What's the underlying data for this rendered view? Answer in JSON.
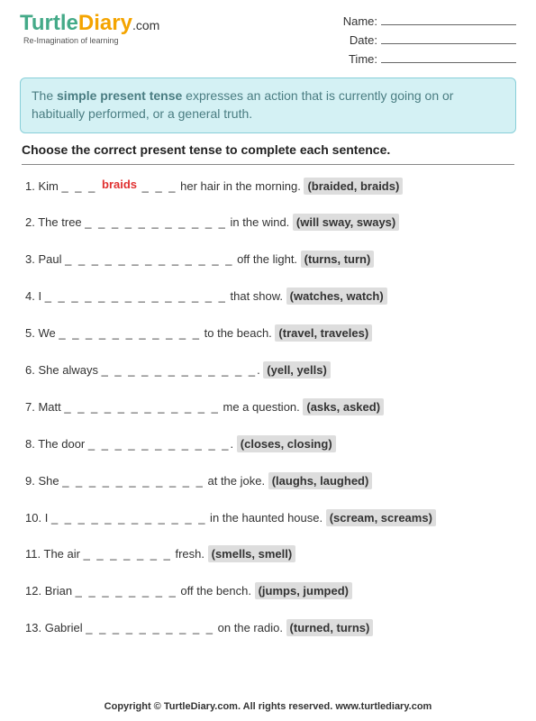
{
  "logo": {
    "brand1": "Turtle",
    "brand2": "Diary",
    "suffix": ".com",
    "tagline": "Re-Imagination of learning"
  },
  "fields": {
    "name_label": "Name:",
    "date_label": "Date:",
    "time_label": "Time:"
  },
  "definition": {
    "pre": "The ",
    "bold": "simple present tense",
    "post": " expresses an action that is currently going on or habitually performed, or a general truth."
  },
  "instruction": "Choose the correct present tense to complete each sentence.",
  "questions": [
    {
      "n": "1.",
      "pre": "Kim ",
      "blank_pre": "_ _ _ ",
      "answer": "braids",
      "blank_post": " _ _ _",
      "post": " her hair in the morning.  ",
      "options": "(braided, braids)"
    },
    {
      "n": "2.",
      "pre": "The tree ",
      "blank_pre": "_ _ _ _ _ _ _ _ _ _ _",
      "answer": "",
      "blank_post": "",
      "post": " in the wind.  ",
      "options": "(will sway, sways)"
    },
    {
      "n": "3.",
      "pre": "Paul ",
      "blank_pre": "_ _ _ _ _ _ _ _ _ _ _ _ _",
      "answer": "",
      "blank_post": "",
      "post": " off the light.  ",
      "options": "(turns, turn)"
    },
    {
      "n": "4.",
      "pre": "I ",
      "blank_pre": "_ _ _ _ _ _ _ _ _ _ _ _ _ _",
      "answer": "",
      "blank_post": "",
      "post": " that show.  ",
      "options": "(watches, watch)"
    },
    {
      "n": "5.",
      "pre": "We ",
      "blank_pre": "_ _ _ _ _ _ _ _ _ _ _",
      "answer": "",
      "blank_post": "",
      "post": " to the beach.  ",
      "options": "(travel, traveles)"
    },
    {
      "n": "6.",
      "pre": "She always ",
      "blank_pre": "_ _ _ _ _ _ _ _ _ _ _ _",
      "answer": "",
      "blank_post": "",
      "post": ".  ",
      "options": "(yell, yells)"
    },
    {
      "n": "7.",
      "pre": "Matt ",
      "blank_pre": "_ _ _ _ _ _ _ _ _ _ _ _",
      "answer": "",
      "blank_post": "",
      "post": " me a question.  ",
      "options": "(asks, asked)"
    },
    {
      "n": "8.",
      "pre": "The door ",
      "blank_pre": "_ _ _ _ _ _ _ _ _ _ _",
      "answer": "",
      "blank_post": "",
      "post": ".  ",
      "options": "(closes, closing)"
    },
    {
      "n": "9.",
      "pre": "She ",
      "blank_pre": "_ _ _ _ _ _ _ _ _ _ _",
      "answer": "",
      "blank_post": "",
      "post": " at the joke.  ",
      "options": "(laughs, laughed)"
    },
    {
      "n": "10.",
      "pre": "I ",
      "blank_pre": "_ _ _ _ _ _ _ _ _ _ _ _",
      "answer": "",
      "blank_post": "",
      "post": " in the haunted house.  ",
      "options": "(scream, screams)"
    },
    {
      "n": "11.",
      "pre": "The air ",
      "blank_pre": "_ _ _ _ _ _ _",
      "answer": "",
      "blank_post": "",
      "post": " fresh.  ",
      "options": "(smells, smell)"
    },
    {
      "n": "12.",
      "pre": "Brian ",
      "blank_pre": "_ _ _ _ _ _ _ _",
      "answer": "",
      "blank_post": "",
      "post": " off the bench.  ",
      "options": "(jumps, jumped)"
    },
    {
      "n": "13.",
      "pre": "Gabriel ",
      "blank_pre": "_ _ _ _ _ _ _ _ _ _",
      "answer": "",
      "blank_post": "",
      "post": " on the radio.  ",
      "options": "(turned, turns)"
    }
  ],
  "footer": "Copyright © TurtleDiary.com. All rights reserved. www.turtlediary.com"
}
